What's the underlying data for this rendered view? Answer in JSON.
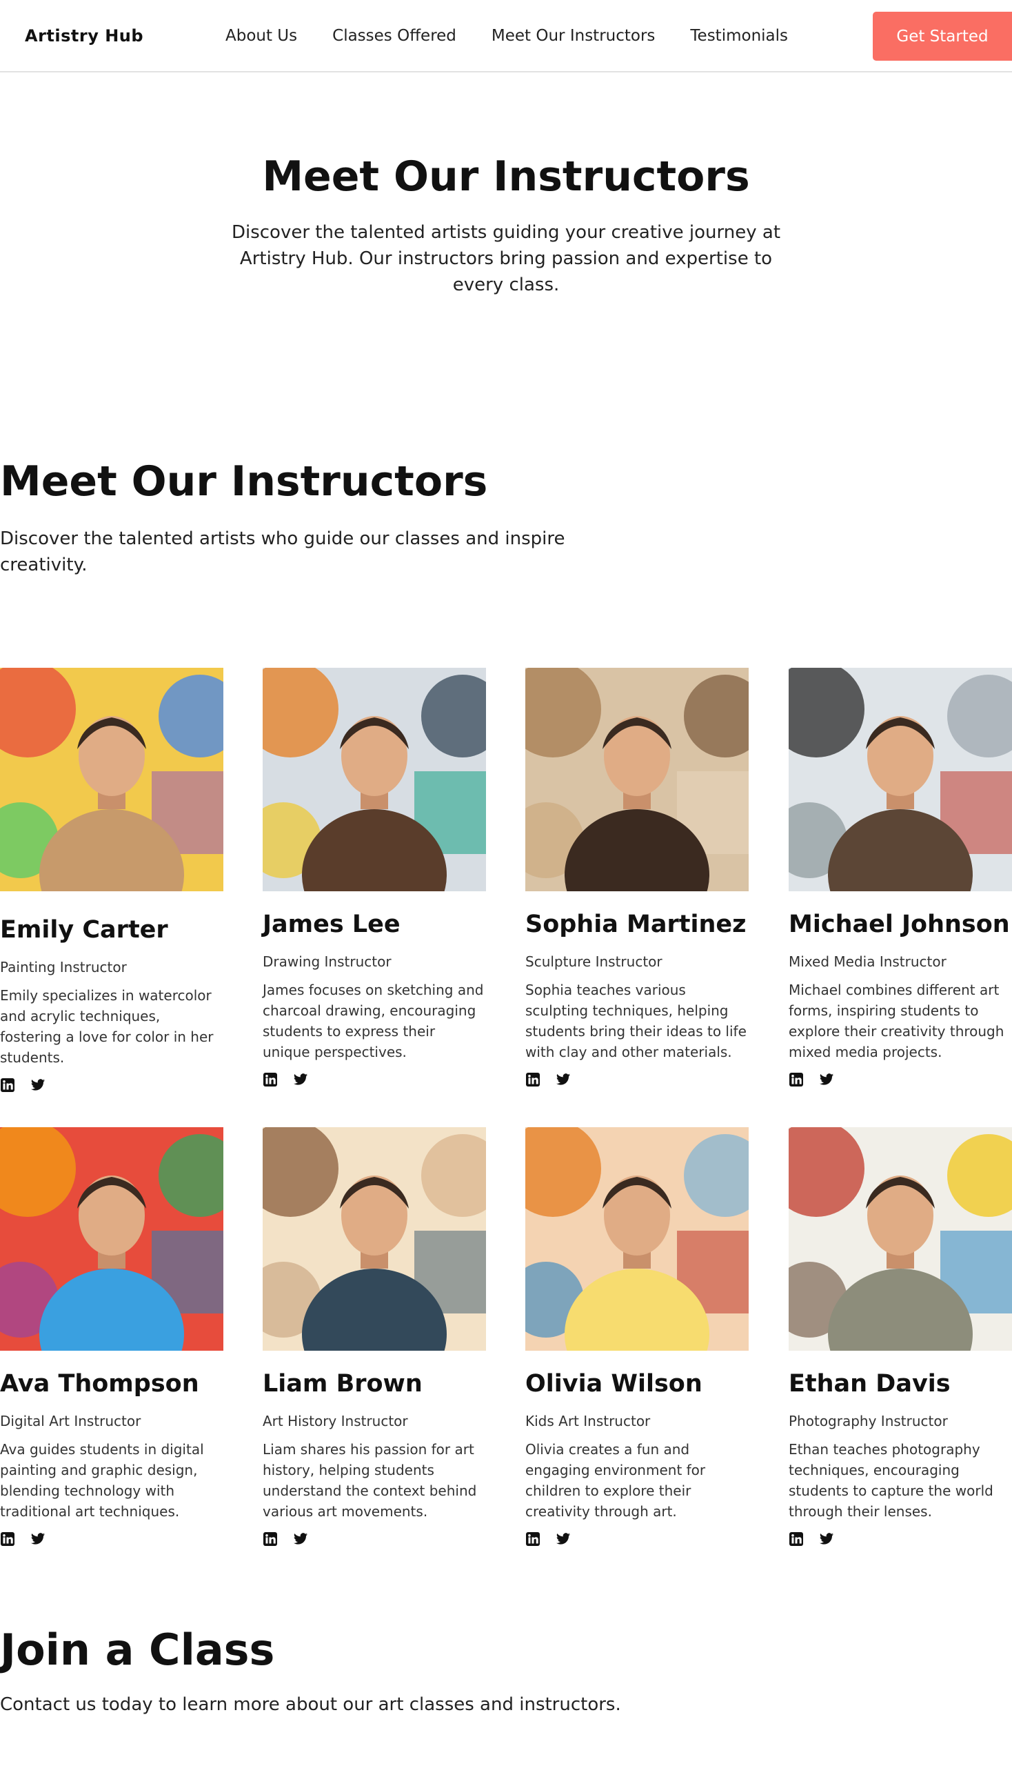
{
  "header": {
    "logo": "Artistry Hub",
    "nav": [
      "About Us",
      "Classes Offered",
      "Meet Our Instructors",
      "Testimonials"
    ],
    "cta": "Get Started",
    "accent_color": "#fa6e63"
  },
  "hero": {
    "title": "Meet Our Instructors",
    "subtitle": "Discover the talented artists guiding your creative journey at Artistry Hub. Our instructors bring passion and expertise to every class."
  },
  "section": {
    "title": "Meet Our Instructors",
    "subtitle": "Discover the talented artists who guide our classes and inspire creativity."
  },
  "instructors": [
    {
      "name": "Emily Carter",
      "role": "Painting Instructor",
      "bio": "Emily specializes in watercolor and acrylic techniques, fostering a love for color in her students.",
      "photo": "portrait-photo",
      "socials": [
        "linkedin-icon",
        "twitter-icon"
      ]
    },
    {
      "name": "James Lee",
      "role": "Drawing Instructor",
      "bio": "James focuses on sketching and charcoal drawing, encouraging students to express their unique perspectives.",
      "photo": "portrait-photo",
      "socials": [
        "linkedin-icon",
        "twitter-icon"
      ]
    },
    {
      "name": "Sophia Martinez",
      "role": "Sculpture Instructor",
      "bio": "Sophia teaches various sculpting techniques, helping students bring their ideas to life with clay and other materials.",
      "photo": "portrait-photo",
      "socials": [
        "linkedin-icon",
        "twitter-icon"
      ]
    },
    {
      "name": "Michael Johnson",
      "role": "Mixed Media Instructor",
      "bio": "Michael combines different art forms, inspiring students to explore their creativity through mixed media projects.",
      "photo": "portrait-photo",
      "socials": [
        "linkedin-icon",
        "twitter-icon"
      ]
    },
    {
      "name": "Ava Thompson",
      "role": "Digital Art Instructor",
      "bio": "Ava guides students in digital painting and graphic design, blending technology with traditional art techniques.",
      "photo": "portrait-photo",
      "socials": [
        "linkedin-icon",
        "twitter-icon"
      ]
    },
    {
      "name": "Liam Brown",
      "role": "Art History Instructor",
      "bio": "Liam shares his passion for art history, helping students understand the context behind various art movements.",
      "photo": "portrait-photo",
      "socials": [
        "linkedin-icon",
        "twitter-icon"
      ]
    },
    {
      "name": "Olivia Wilson",
      "role": "Kids Art Instructor",
      "bio": "Olivia creates a fun and engaging environment for children to explore their creativity through art.",
      "photo": "portrait-photo",
      "socials": [
        "linkedin-icon",
        "twitter-icon"
      ]
    },
    {
      "name": "Ethan Davis",
      "role": "Photography Instructor",
      "bio": "Ethan teaches photography techniques, encouraging students to capture the world through their lenses.",
      "photo": "portrait-photo",
      "socials": [
        "linkedin-icon",
        "twitter-icon"
      ]
    }
  ],
  "join": {
    "title": "Join a Class",
    "subtitle": "Contact us today to learn more about our art classes and instructors."
  }
}
